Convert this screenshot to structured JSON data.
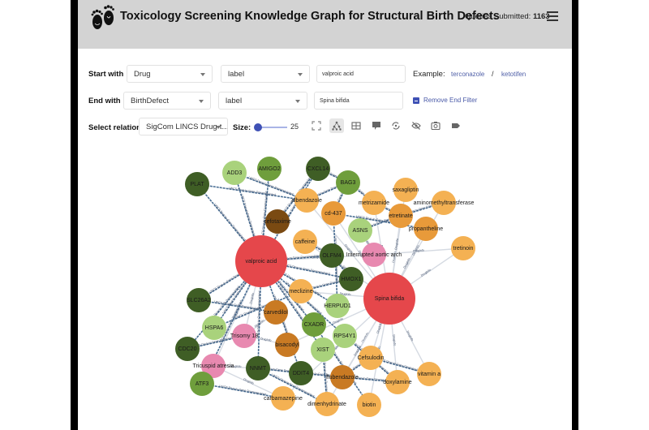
{
  "header": {
    "title": "Toxicology Screening Knowledge Graph for Structural Birth Defects",
    "queries_label": "Queries Submitted:",
    "queries_count": "1163",
    "logo_icon": "baby-footprints-icon",
    "menu_icon": "hamburger-menu-icon"
  },
  "filters": {
    "start": {
      "label": "Start with",
      "type_value": "Drug",
      "field_value": "label",
      "text_value": "valproic acid"
    },
    "end": {
      "label": "End with",
      "type_value": "BirthDefect",
      "field_value": "label",
      "text_value": "Spina bifida"
    },
    "example_label": "Example:",
    "examples": [
      "terconazole",
      "ketotifen"
    ],
    "example_separator": "/",
    "remove_end_filter_label": "Remove End Filter",
    "remove_end_filter_checked": true
  },
  "toolbar": {
    "relation_label": "Select relation:",
    "relation_value": "SigCom LINCS Drug-t...",
    "size_label": "Size:",
    "size_value": "25",
    "size_fraction": 0.1,
    "tools": [
      {
        "name": "fullscreen-icon",
        "active": false
      },
      {
        "name": "network-layout-icon",
        "active": true
      },
      {
        "name": "table-view-icon",
        "active": false
      },
      {
        "name": "comment-icon",
        "active": false
      },
      {
        "name": "refresh-layout-icon",
        "active": false
      },
      {
        "name": "hide-labels-icon",
        "active": false
      },
      {
        "name": "screenshot-camera-icon",
        "active": false
      },
      {
        "name": "tag-icon",
        "active": false
      }
    ]
  },
  "graph": {
    "colors": {
      "drug_light": "#f4b153",
      "drug_mid": "#e89a3a",
      "drug_dark": "#c97a23",
      "drug_brown": "#7a4a12",
      "gene_light": "#a9d27c",
      "gene_mid": "#6f9e3c",
      "gene_dark": "#3f5e25",
      "phenotype": "#e889b0",
      "focus": "#e5474b",
      "edge_lincs": "#4a6f94",
      "edge_druginfo": "#d5dae2"
    },
    "edge_labels": {
      "lincs": "LINCS Drug-to-Gene Downregulated",
      "druginfo": "DrugInfo"
    },
    "nodes": [
      {
        "id": "valproic acid",
        "kind": "focus",
        "color": "focus",
        "big": true
      },
      {
        "id": "Spina bifida",
        "kind": "focus",
        "color": "focus",
        "big": true
      },
      {
        "id": "PLAT",
        "color": "gene_dark"
      },
      {
        "id": "ADD3",
        "color": "gene_light"
      },
      {
        "id": "AMIGO2",
        "color": "gene_mid"
      },
      {
        "id": "CXCL14",
        "color": "gene_dark"
      },
      {
        "id": "BAG3",
        "color": "gene_mid"
      },
      {
        "id": "albendazole",
        "color": "drug_light"
      },
      {
        "id": "saxagliptin",
        "color": "drug_light"
      },
      {
        "id": "cefotaxime",
        "color": "drug_brown"
      },
      {
        "id": "cd-437",
        "color": "drug_mid"
      },
      {
        "id": "metrizamide",
        "color": "drug_light"
      },
      {
        "id": "aminomethyltransferase",
        "color": "drug_light"
      },
      {
        "id": "etretinate",
        "color": "drug_mid"
      },
      {
        "id": "caffeine",
        "color": "drug_light"
      },
      {
        "id": "ASNS",
        "color": "gene_light"
      },
      {
        "id": "propantheline",
        "color": "drug_mid"
      },
      {
        "id": "OLFM4",
        "color": "gene_dark"
      },
      {
        "id": "Interrupted aortic arch",
        "color": "phenotype"
      },
      {
        "id": "tretinoin",
        "color": "drug_light"
      },
      {
        "id": "HMOX1",
        "color": "gene_dark"
      },
      {
        "id": "SLC26A2",
        "color": "gene_dark"
      },
      {
        "id": "meclizine",
        "color": "drug_light"
      },
      {
        "id": "HERPUD1",
        "color": "gene_light"
      },
      {
        "id": "carvedilol",
        "color": "drug_dark"
      },
      {
        "id": "HSPA6",
        "color": "gene_light"
      },
      {
        "id": "CXADR",
        "color": "gene_mid"
      },
      {
        "id": "Trisomy 18",
        "color": "phenotype"
      },
      {
        "id": "RPS4Y1",
        "color": "gene_light"
      },
      {
        "id": "bisacodyl",
        "color": "drug_dark"
      },
      {
        "id": "CDC20",
        "color": "gene_dark"
      },
      {
        "id": "XIST",
        "color": "gene_light"
      },
      {
        "id": "Cefsulodin",
        "color": "drug_light"
      },
      {
        "id": "Tricuspid atresia",
        "color": "phenotype"
      },
      {
        "id": "vitamin a",
        "color": "drug_light"
      },
      {
        "id": "ATF3",
        "color": "gene_mid"
      },
      {
        "id": "NNMT",
        "color": "gene_dark"
      },
      {
        "id": "DDIT4",
        "color": "gene_dark"
      },
      {
        "id": "flubendazole",
        "color": "drug_dark"
      },
      {
        "id": "doxylamine",
        "color": "drug_light"
      },
      {
        "id": "carbamazepine",
        "color": "drug_light"
      },
      {
        "id": "dimenhydrinate",
        "color": "drug_light"
      },
      {
        "id": "biotin",
        "color": "drug_light"
      }
    ]
  }
}
